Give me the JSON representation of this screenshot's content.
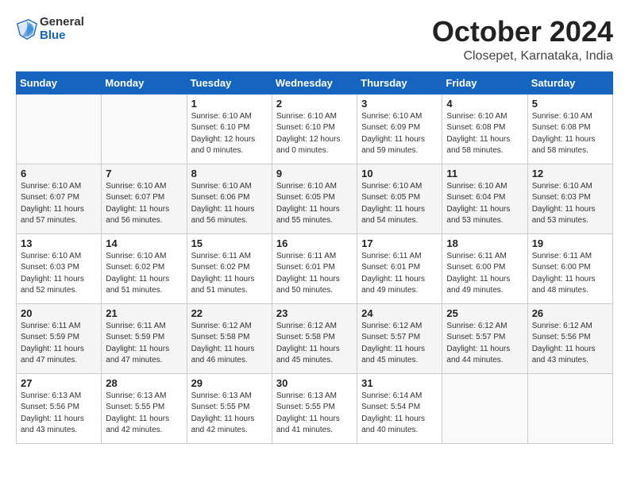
{
  "header": {
    "logo_general": "General",
    "logo_blue": "Blue",
    "month_title": "October 2024",
    "subtitle": "Closepet, Karnataka, India"
  },
  "weekdays": [
    "Sunday",
    "Monday",
    "Tuesday",
    "Wednesday",
    "Thursday",
    "Friday",
    "Saturday"
  ],
  "weeks": [
    [
      {
        "day": "",
        "info": ""
      },
      {
        "day": "",
        "info": ""
      },
      {
        "day": "1",
        "info": "Sunrise: 6:10 AM\nSunset: 6:10 PM\nDaylight: 12 hours\nand 0 minutes."
      },
      {
        "day": "2",
        "info": "Sunrise: 6:10 AM\nSunset: 6:10 PM\nDaylight: 12 hours\nand 0 minutes."
      },
      {
        "day": "3",
        "info": "Sunrise: 6:10 AM\nSunset: 6:09 PM\nDaylight: 11 hours\nand 59 minutes."
      },
      {
        "day": "4",
        "info": "Sunrise: 6:10 AM\nSunset: 6:08 PM\nDaylight: 11 hours\nand 58 minutes."
      },
      {
        "day": "5",
        "info": "Sunrise: 6:10 AM\nSunset: 6:08 PM\nDaylight: 11 hours\nand 58 minutes."
      }
    ],
    [
      {
        "day": "6",
        "info": "Sunrise: 6:10 AM\nSunset: 6:07 PM\nDaylight: 11 hours\nand 57 minutes."
      },
      {
        "day": "7",
        "info": "Sunrise: 6:10 AM\nSunset: 6:07 PM\nDaylight: 11 hours\nand 56 minutes."
      },
      {
        "day": "8",
        "info": "Sunrise: 6:10 AM\nSunset: 6:06 PM\nDaylight: 11 hours\nand 56 minutes."
      },
      {
        "day": "9",
        "info": "Sunrise: 6:10 AM\nSunset: 6:05 PM\nDaylight: 11 hours\nand 55 minutes."
      },
      {
        "day": "10",
        "info": "Sunrise: 6:10 AM\nSunset: 6:05 PM\nDaylight: 11 hours\nand 54 minutes."
      },
      {
        "day": "11",
        "info": "Sunrise: 6:10 AM\nSunset: 6:04 PM\nDaylight: 11 hours\nand 53 minutes."
      },
      {
        "day": "12",
        "info": "Sunrise: 6:10 AM\nSunset: 6:03 PM\nDaylight: 11 hours\nand 53 minutes."
      }
    ],
    [
      {
        "day": "13",
        "info": "Sunrise: 6:10 AM\nSunset: 6:03 PM\nDaylight: 11 hours\nand 52 minutes."
      },
      {
        "day": "14",
        "info": "Sunrise: 6:10 AM\nSunset: 6:02 PM\nDaylight: 11 hours\nand 51 minutes."
      },
      {
        "day": "15",
        "info": "Sunrise: 6:11 AM\nSunset: 6:02 PM\nDaylight: 11 hours\nand 51 minutes."
      },
      {
        "day": "16",
        "info": "Sunrise: 6:11 AM\nSunset: 6:01 PM\nDaylight: 11 hours\nand 50 minutes."
      },
      {
        "day": "17",
        "info": "Sunrise: 6:11 AM\nSunset: 6:01 PM\nDaylight: 11 hours\nand 49 minutes."
      },
      {
        "day": "18",
        "info": "Sunrise: 6:11 AM\nSunset: 6:00 PM\nDaylight: 11 hours\nand 49 minutes."
      },
      {
        "day": "19",
        "info": "Sunrise: 6:11 AM\nSunset: 6:00 PM\nDaylight: 11 hours\nand 48 minutes."
      }
    ],
    [
      {
        "day": "20",
        "info": "Sunrise: 6:11 AM\nSunset: 5:59 PM\nDaylight: 11 hours\nand 47 minutes."
      },
      {
        "day": "21",
        "info": "Sunrise: 6:11 AM\nSunset: 5:59 PM\nDaylight: 11 hours\nand 47 minutes."
      },
      {
        "day": "22",
        "info": "Sunrise: 6:12 AM\nSunset: 5:58 PM\nDaylight: 11 hours\nand 46 minutes."
      },
      {
        "day": "23",
        "info": "Sunrise: 6:12 AM\nSunset: 5:58 PM\nDaylight: 11 hours\nand 45 minutes."
      },
      {
        "day": "24",
        "info": "Sunrise: 6:12 AM\nSunset: 5:57 PM\nDaylight: 11 hours\nand 45 minutes."
      },
      {
        "day": "25",
        "info": "Sunrise: 6:12 AM\nSunset: 5:57 PM\nDaylight: 11 hours\nand 44 minutes."
      },
      {
        "day": "26",
        "info": "Sunrise: 6:12 AM\nSunset: 5:56 PM\nDaylight: 11 hours\nand 43 minutes."
      }
    ],
    [
      {
        "day": "27",
        "info": "Sunrise: 6:13 AM\nSunset: 5:56 PM\nDaylight: 11 hours\nand 43 minutes."
      },
      {
        "day": "28",
        "info": "Sunrise: 6:13 AM\nSunset: 5:55 PM\nDaylight: 11 hours\nand 42 minutes."
      },
      {
        "day": "29",
        "info": "Sunrise: 6:13 AM\nSunset: 5:55 PM\nDaylight: 11 hours\nand 42 minutes."
      },
      {
        "day": "30",
        "info": "Sunrise: 6:13 AM\nSunset: 5:55 PM\nDaylight: 11 hours\nand 41 minutes."
      },
      {
        "day": "31",
        "info": "Sunrise: 6:14 AM\nSunset: 5:54 PM\nDaylight: 11 hours\nand 40 minutes."
      },
      {
        "day": "",
        "info": ""
      },
      {
        "day": "",
        "info": ""
      }
    ]
  ]
}
